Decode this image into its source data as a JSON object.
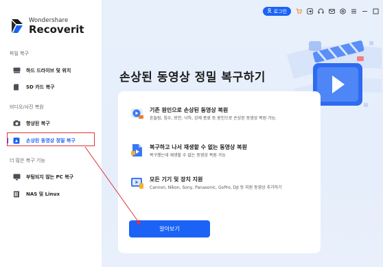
{
  "app": {
    "brand_top": "Wondershare",
    "brand_name": "Recoverit",
    "accent": "#1a63f6",
    "highlight": "#e0333a"
  },
  "sidebar": {
    "sections": [
      {
        "title": "파일 복구",
        "items": [
          {
            "label": "하드 드라이브 및 위치",
            "icon": "hard-drive-icon"
          },
          {
            "label": "SD 카드 복구",
            "icon": "sd-card-icon"
          }
        ]
      },
      {
        "title": "비디오/사진 복원",
        "items": [
          {
            "label": "향상된 복구",
            "icon": "camera-icon"
          },
          {
            "label": "손상된 동영상 정밀 복구",
            "icon": "video-repair-icon",
            "active": true
          }
        ]
      },
      {
        "title": "더 많은 복구 기능",
        "items": [
          {
            "label": "부팅되지 않는 PC 복구",
            "icon": "monitor-icon"
          },
          {
            "label": "NAS 및 Linux",
            "icon": "nas-icon"
          }
        ]
      }
    ]
  },
  "topbar": {
    "login_label": "로그인",
    "icons": [
      "cart-icon",
      "export-icon",
      "headset-icon",
      "mail-icon",
      "settings-icon",
      "menu-icon",
      "minimize-icon",
      "maximize-icon"
    ]
  },
  "main": {
    "title": "손상된 동영상 정밀 복구하기",
    "features": [
      {
        "title": "기존 원인으로 손상된 동영상 복원",
        "desc": "흔들림, 침수, 방전, 낙하, 강제 종료 등 원인으로 손상된 동영상 복원 가능.",
        "icon": "video-damage-icon"
      },
      {
        "title": "복구하고 나서 재생할 수 없는 동영상 복원",
        "desc": "복구했는데 재생할 수 없는 동영상 복원 가능",
        "icon": "file-video-icon"
      },
      {
        "title": "모든 기기 및 장치 지원",
        "desc": "Cannon, Nikon, Sony, Panasonic, GoPro, DJI 등 지원 동영상 추가하기",
        "icon": "device-video-icon"
      }
    ],
    "learn_more_label": "알아보기"
  }
}
